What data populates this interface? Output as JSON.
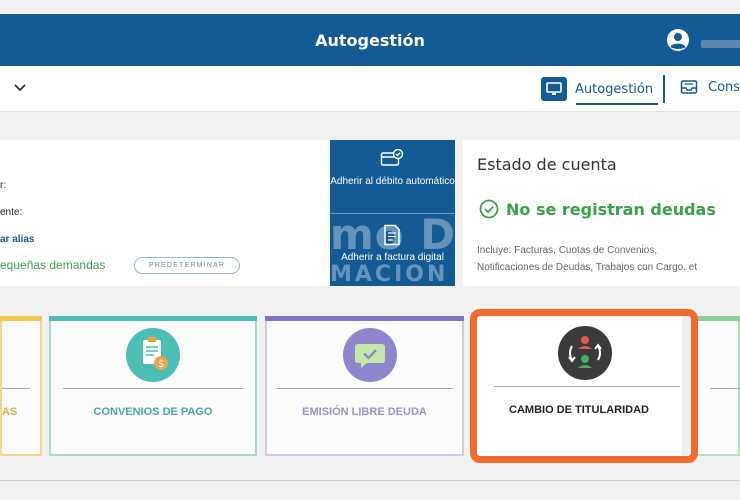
{
  "header": {
    "title": "Autogestión"
  },
  "nav": {
    "tabs": [
      {
        "label": "Autogestión",
        "icon": "monitor-icon",
        "active": true
      },
      {
        "label": "Cons",
        "icon": "inbox-icon"
      }
    ]
  },
  "account_card": {
    "line1": "r:",
    "line2": "ente:",
    "alias_link": "ar alias",
    "pequenas": "equeñas demandas",
    "predeterminar": "PREDETERMINAR"
  },
  "actions": {
    "debito": "Adherir al débito automático",
    "factura": "Adherir a factura digital"
  },
  "estado": {
    "title": "Estado de cuenta",
    "status": "No se registran deudas",
    "includes_line1": "Incluye: Facturas, Cuotas de Convenios,",
    "includes_line2": "Notificaciones de Deudas, Trabajos con Cargo, et"
  },
  "watermark": {
    "line1": "mo D",
    "line2": "MACION"
  },
  "tiles": [
    {
      "label": "AS"
    },
    {
      "label": "CONVENIOS DE PAGO"
    },
    {
      "label": "EMISIÓN LIBRE DEUDA"
    },
    {
      "label": "CAMBIO DE TITULARIDAD"
    },
    {
      "label": ""
    }
  ],
  "colors": {
    "brand": "#145a94",
    "success": "#3aa04a",
    "highlight": "#f26a2e"
  }
}
